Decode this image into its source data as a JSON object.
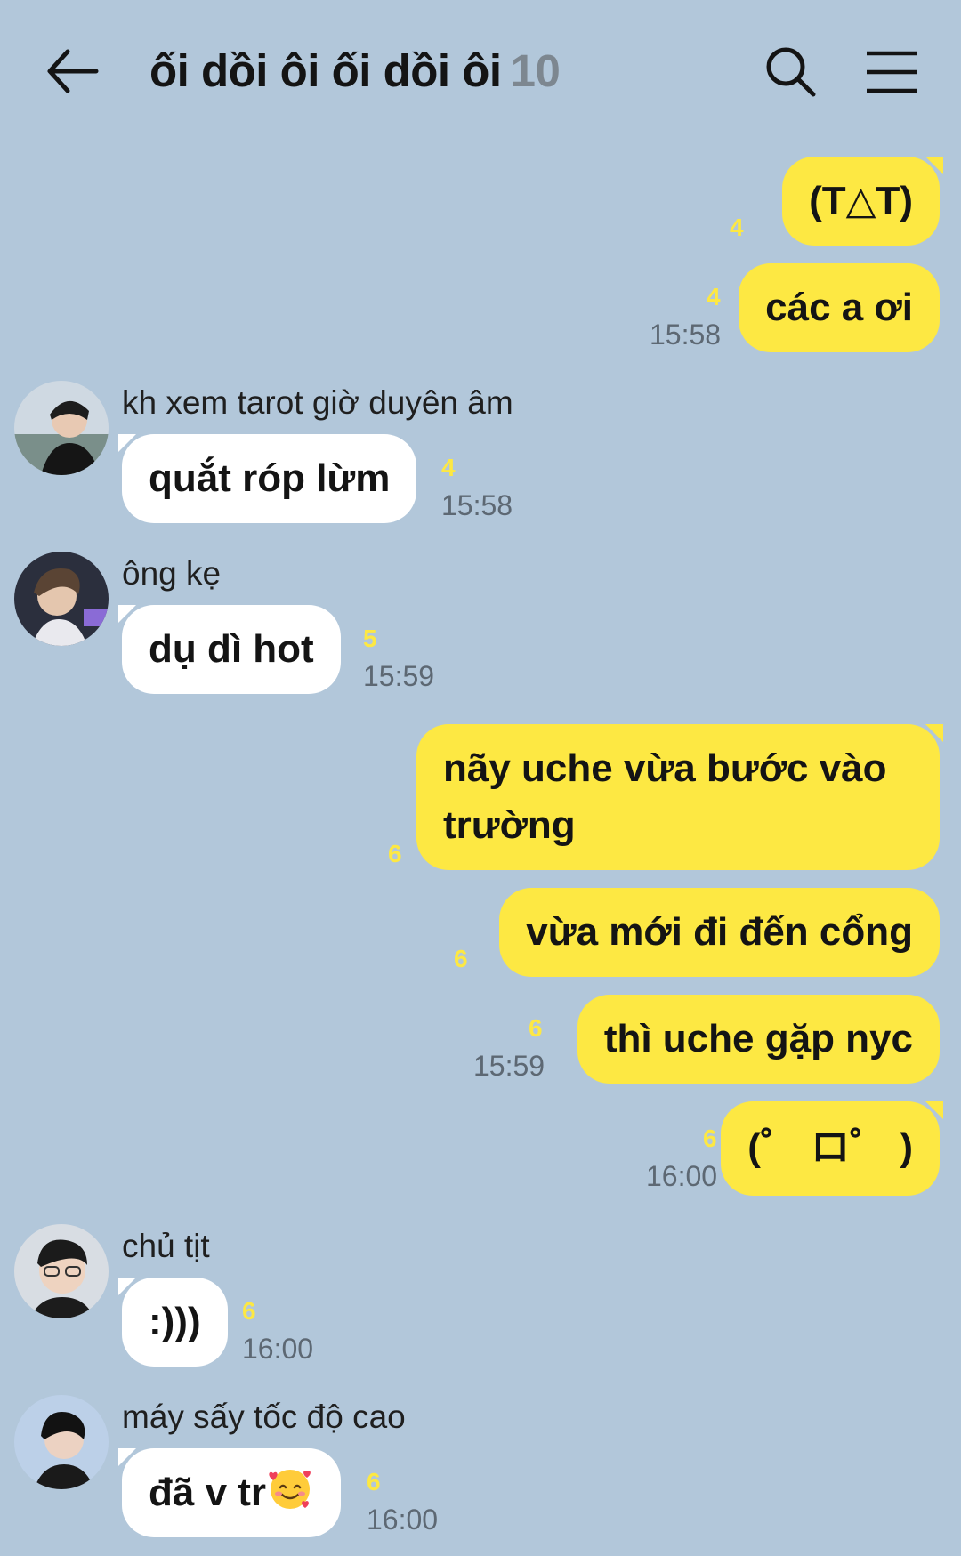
{
  "header": {
    "title": "ối dồi ôi ối dồi ôi",
    "member_count": "10"
  },
  "messages": [
    {
      "id": 1,
      "from": "me",
      "text": "(T△T)",
      "unread": "4",
      "time": ""
    },
    {
      "id": 2,
      "from": "me",
      "text": "các a ơi",
      "unread": "4",
      "time": "15:58"
    },
    {
      "id": 3,
      "from": "kh xem tarot giờ duyên âm",
      "text": "quắt róp lừm",
      "unread": "4",
      "time": "15:58"
    },
    {
      "id": 4,
      "from": "ông kẹ",
      "text": "dụ dì hot",
      "unread": "5",
      "time": "15:59"
    },
    {
      "id": 5,
      "from": "me",
      "text": "nãy uche vừa bước vào trường",
      "unread": "6",
      "time": ""
    },
    {
      "id": 6,
      "from": "me",
      "text": "vừa mới đi đến cổng",
      "unread": "6",
      "time": ""
    },
    {
      "id": 7,
      "from": "me",
      "text": "thì uche gặp nyc",
      "unread": "6",
      "time": "15:59"
    },
    {
      "id": 8,
      "from": "me",
      "text": "(゜ ロ゜ )",
      "unread": "6",
      "time": "16:00"
    },
    {
      "id": 9,
      "from": "chủ tịt",
      "text": ":)))",
      "unread": "6",
      "time": "16:00"
    },
    {
      "id": 10,
      "from": "máy sấy tốc độ cao",
      "text": "đã v tr",
      "emoji": "smiling-face-with-hearts",
      "unread": "6",
      "time": "16:00"
    }
  ],
  "colors": {
    "background": "#b2c7da",
    "my_bubble": "#fde843",
    "other_bubble": "#ffffff",
    "unread_count": "#fde843",
    "timestamp": "#5d6873"
  },
  "icons": [
    "back-arrow-icon",
    "search-icon",
    "menu-icon"
  ]
}
